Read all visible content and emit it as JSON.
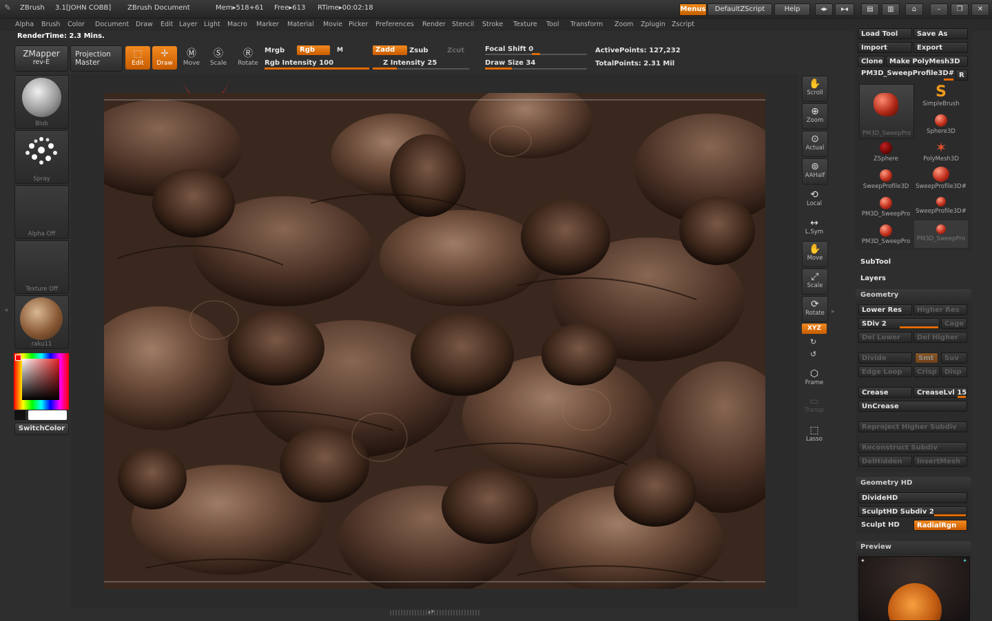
{
  "titlebar": {
    "app": "ZBrush",
    "version": "3.1[JOHN COBB]",
    "document": "ZBrush Document",
    "mem": "Mem▸518+61",
    "free": "Free▸613",
    "rtime": "RTime▸00:02:18",
    "menus_btn": "Menus",
    "script_btn": "DefaultZScript",
    "help_btn": "Help"
  },
  "menu": [
    "Alpha",
    "Brush",
    "Color",
    "Document",
    "Draw",
    "Edit",
    "Layer",
    "Light",
    "Macro",
    "Marker",
    "Material",
    "Movie",
    "Picker",
    "Preferences",
    "Render",
    "Stencil",
    "Stroke",
    "Texture",
    "Tool",
    "Transform",
    "Zoom",
    "Zplugin",
    "Zscript"
  ],
  "render_time": "RenderTime: 2.3  Mins.",
  "shelf": {
    "zmapper": "ZMapper",
    "zmapper_sub": "rev-E",
    "projection": "Projection",
    "projection_sub": "Master",
    "edit": "Edit",
    "draw": "Draw",
    "move": "Move",
    "scale": "Scale",
    "rotate": "Rotate",
    "mrgb": "Mrgb",
    "rgb": "Rgb",
    "m": "M",
    "rgb_intensity": "Rgb  Intensity 100",
    "zadd": "Zadd",
    "zsub": "Zsub",
    "zcut": "Zcut",
    "z_intensity": "Z  Intensity 25",
    "focal_shift": "Focal  Shift 0",
    "draw_size": "Draw  Size 34",
    "active_points": "ActivePoints: 127,232",
    "total_points": "TotalPoints: 2.31  Mil",
    "rgb_intensity_value": 100,
    "z_intensity_value": 25,
    "focal_shift_value": 0,
    "draw_size_value": 34
  },
  "left_palette": {
    "brush": "Blob",
    "stroke": "Spray",
    "alpha": "Alpha  Off",
    "texture": "Texture  Off",
    "material": "raku11",
    "switch_color": "SwitchColor"
  },
  "right_toolbar": {
    "scroll": "Scroll",
    "zoom": "Zoom",
    "actual": "Actual",
    "aahalf": "AAHalf",
    "local": "Local",
    "lsym": "L.Sym",
    "move": "Move",
    "scale": "Scale",
    "rotate": "Rotate",
    "xyz": "XYZ",
    "frame": "Frame",
    "transp": "Transp",
    "lasso": "Lasso"
  },
  "tool_panel": {
    "load_tool": "Load  Tool",
    "save_as": "Save  As",
    "import": "Import",
    "export": "Export",
    "clone": "Clone",
    "make_polymesh": "Make  PolyMesh3D",
    "current_tool": "PM3D_SweepProfile3D#",
    "r_btn": "R",
    "tools": [
      {
        "label": "PM3D_SweepPro"
      },
      {
        "label": "SimpleBrush"
      },
      {
        "label": "Sphere3D"
      },
      {
        "label": "ZSphere"
      },
      {
        "label": "PolyMesh3D"
      },
      {
        "label": "SweepProfile3D"
      },
      {
        "label": "SweepProfile3D#"
      },
      {
        "label": "PM3D_SweepPro"
      },
      {
        "label": "SweepProfile3D#"
      },
      {
        "label": "PM3D_SweepPro"
      },
      {
        "label": "PM3D_SweepPro"
      }
    ],
    "subtool": "SubTool",
    "layers": "Layers"
  },
  "geometry": {
    "header": "Geometry",
    "lower_res": "Lower  Res",
    "higher_res": "Higher  Res",
    "sdiv": "SDiv 2",
    "cage": "Cage",
    "del_lower": "Del  Lower",
    "del_higher": "Del  Higher",
    "divide": "Divide",
    "smt": "Smt",
    "suv": "Suv",
    "edge_loop": "Edge  Loop",
    "crisp": "Crisp",
    "disp": "Disp",
    "crease": "Crease",
    "crease_lvl": "CreaseLvl 15",
    "uncrease": "UnCrease",
    "reproject": "Reproject  Higher  Subdiv",
    "reconstruct": "Reconstruct  Subdiv",
    "delhidden": "DelHidden",
    "insertmesh": "InsertMesh",
    "sdiv_value": 2,
    "crease_lvl_value": 15
  },
  "geometry_hd": {
    "header": "Geometry  HD",
    "dividehd": "DivideHD",
    "sculpthd_subdiv": "SculptHD  Subdiv 2",
    "sculpt_hd": "Sculpt  HD",
    "radialrgn": "RadialRgn"
  },
  "preview": {
    "header": "Preview"
  },
  "colors": {
    "accent": "#e8760f",
    "panel_bg": "#2e2e2e",
    "canvas_bg": "#3c2a20"
  }
}
